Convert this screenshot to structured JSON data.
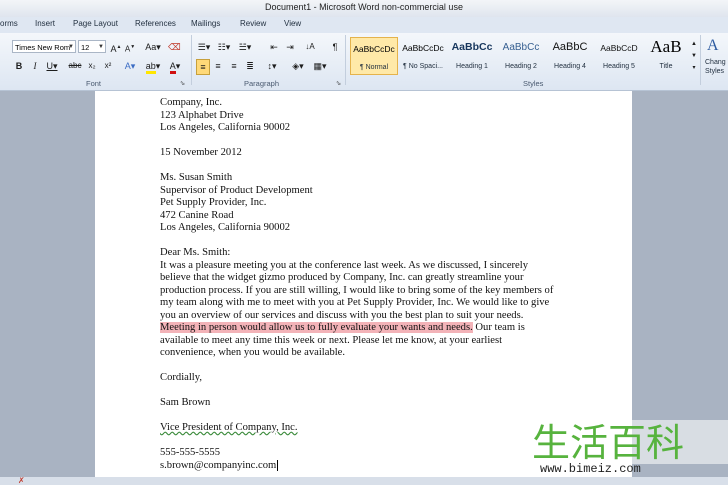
{
  "window": {
    "title": "Document1 - Microsoft Word non-commercial use"
  },
  "tabs": [
    "orms",
    "Insert",
    "Page Layout",
    "References",
    "Mailings",
    "Review",
    "View"
  ],
  "ribbon": {
    "font_name": "Times New Rom",
    "font_size": "12",
    "groups": {
      "font": "Font",
      "paragraph": "Paragraph",
      "styles": "Styles"
    },
    "styles": [
      {
        "sample": "AaBbCcDc",
        "name": "¶ Normal"
      },
      {
        "sample": "AaBbCcDc",
        "name": "¶ No Spaci..."
      },
      {
        "sample": "AaBbCc",
        "name": "Heading 1"
      },
      {
        "sample": "AaBbCc",
        "name": "Heading 2"
      },
      {
        "sample": "AaBbC",
        "name": "Heading 4"
      },
      {
        "sample": "AaBbCcD",
        "name": "Heading 5"
      },
      {
        "sample": "AaB",
        "name": "Title"
      }
    ],
    "change_styles": [
      "Chang",
      "Styles"
    ]
  },
  "document": {
    "lines": [
      "Company, Inc.",
      "123 Alphabet Drive",
      "Los Angeles, California 90002",
      "",
      "15 November 2012",
      "",
      "Ms. Susan Smith",
      "Supervisor of Product Development",
      "Pet Supply Provider, Inc.",
      "472 Canine Road",
      "Los Angeles, California 90002",
      "",
      "Dear Ms. Smith:",
      "It was a pleasure meeting you at the conference last week. As we discussed, I sincerely",
      "believe that the widget gizmo produced by Company, Inc. can greatly streamline  your",
      "production process. If you are still willing, I would like to bring some of the key members  of",
      "my team along with me to meet with you at Pet Supply Provider, Inc. We would like to give",
      "you an overview of our services  and discuss with you the best plan to suit your needs."
    ],
    "highlight": "Meeting in person would allow us to fully evaluate your wants and needs.",
    "after_highlight": " Our team is",
    "lines2": [
      "available to meet any time this week or next. Please let me know, at your earliest",
      "convenience, when you would be available.",
      "",
      "Cordially,",
      "",
      "Sam Brown",
      ""
    ],
    "vp_line": "Vice President of Company, Inc.",
    "phone": "555-555-5555",
    "email": "s.brown@companyinc.com"
  },
  "watermark": {
    "cjk": "生活百科",
    "url": "www.bimeiz.com"
  }
}
